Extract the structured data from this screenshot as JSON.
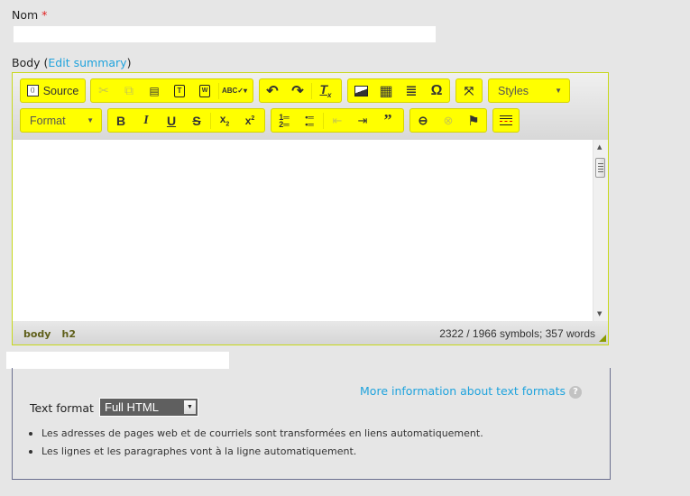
{
  "name_field": {
    "label": "Nom",
    "required_marker": "*",
    "value": ""
  },
  "body_field": {
    "label": "Body (",
    "edit_summary_link": "Edit summary",
    "label_close": ")"
  },
  "toolbar": {
    "row1": {
      "source": {
        "icon": "source-icon",
        "label": "Source"
      },
      "clipboard": [
        {
          "name": "cut",
          "icon": "scissors-icon",
          "glyph": "✂",
          "disabled": true
        },
        {
          "name": "copy",
          "icon": "copy-icon",
          "glyph": "⎘",
          "disabled": true
        },
        {
          "name": "paste",
          "icon": "paste-icon",
          "glyph": "📋",
          "disabled": false
        },
        {
          "name": "paste-text",
          "icon": "paste-text-icon",
          "glyph": "T",
          "disabled": false
        },
        {
          "name": "paste-word",
          "icon": "paste-word-icon",
          "glyph": "W",
          "disabled": false
        },
        {
          "name": "spellcheck",
          "icon": "spellcheck-icon",
          "glyph": "ABC▾",
          "disabled": false
        }
      ],
      "history": [
        {
          "name": "undo",
          "icon": "undo-icon",
          "glyph": "↶"
        },
        {
          "name": "redo",
          "icon": "redo-icon",
          "glyph": "↷"
        },
        {
          "name": "remove-format",
          "icon": "remove-format-icon",
          "glyph": "Tx"
        }
      ],
      "insert": [
        {
          "name": "image",
          "icon": "image-icon",
          "glyph": "🖼"
        },
        {
          "name": "table",
          "icon": "table-icon",
          "glyph": "▦"
        },
        {
          "name": "horizontal-line",
          "icon": "horizontal-line-icon",
          "glyph": "≡"
        },
        {
          "name": "special-char",
          "icon": "omega-icon",
          "glyph": "Ω"
        }
      ],
      "maximize": {
        "name": "maximize",
        "icon": "maximize-icon",
        "glyph": "⤢"
      },
      "styles": {
        "label": "Styles",
        "value": ""
      }
    },
    "row2": {
      "format": {
        "label": "Format",
        "value": ""
      },
      "basic": [
        {
          "name": "bold",
          "icon": "bold-icon",
          "glyph": "B"
        },
        {
          "name": "italic",
          "icon": "italic-icon",
          "glyph": "I"
        },
        {
          "name": "underline",
          "icon": "underline-icon",
          "glyph": "U"
        },
        {
          "name": "strike",
          "icon": "strikethrough-icon",
          "glyph": "S"
        },
        {
          "name": "subscript",
          "icon": "subscript-icon",
          "glyph": "x₂"
        },
        {
          "name": "superscript",
          "icon": "superscript-icon",
          "glyph": "x²"
        }
      ],
      "lists": [
        {
          "name": "numbered-list",
          "icon": "numbered-list-icon",
          "glyph": "⒈"
        },
        {
          "name": "bulleted-list",
          "icon": "bulleted-list-icon",
          "glyph": "•≡"
        },
        {
          "name": "outdent",
          "icon": "outdent-icon",
          "glyph": "⇤",
          "disabled": true
        },
        {
          "name": "indent",
          "icon": "indent-icon",
          "glyph": "⇥"
        },
        {
          "name": "blockquote",
          "icon": "blockquote-icon",
          "glyph": "❞"
        }
      ],
      "links": [
        {
          "name": "link",
          "icon": "link-icon",
          "glyph": "⊖"
        },
        {
          "name": "unlink",
          "icon": "unlink-icon",
          "glyph": "⊗",
          "disabled": true
        },
        {
          "name": "anchor",
          "icon": "flag-icon",
          "glyph": "⚑"
        }
      ],
      "pagebreak": {
        "name": "page-break",
        "icon": "page-break-icon",
        "glyph": "≣"
      }
    }
  },
  "editor_footer": {
    "path": [
      "body",
      "h2"
    ],
    "counter": "2322 / 1966 symbols; 357 words"
  },
  "text_format": {
    "more_info_link": "More information about text formats",
    "help_icon": "?",
    "label": "Text format",
    "selected": "Full HTML",
    "tips": [
      "Les adresses de pages web et de courriels sont transformées en liens automatiquement.",
      "Les lignes et les paragraphes vont à la ligne automatiquement."
    ]
  },
  "colors": {
    "toolbar_button_bg": "#ffff00",
    "editor_border": "#c7d81b",
    "link": "#1fa3dd",
    "select_bg": "#5f5f5f"
  }
}
